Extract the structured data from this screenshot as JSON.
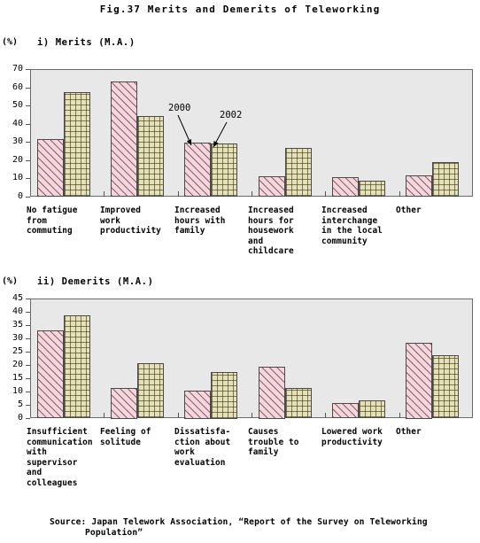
{
  "figure": {
    "title": "Fig.37 Merits and Demerits of Teleworking",
    "source_line1": "Source: Japan Telework Association, “Report of the Survey on Teleworking",
    "source_line2": "Population”"
  },
  "legend_annotations": [
    {
      "label": "2000",
      "series": "2000"
    },
    {
      "label": "2002",
      "series": "2002"
    }
  ],
  "colors": {
    "series_2000_fill": "#f6d5dd",
    "series_2002_fill": "#e4e0b8",
    "plot_background": "#e8e8e8",
    "axis": "#555555",
    "bar_border": "#4a4a4a"
  },
  "panels": [
    {
      "id": "merits",
      "heading": "i) Merits (M.A.)",
      "unit": "(%)"
    },
    {
      "id": "demerits",
      "heading": "ii) Demerits (M.A.)",
      "unit": "(%)"
    }
  ],
  "chart_data": [
    {
      "type": "bar",
      "title": "i) Merits (M.A.)",
      "xlabel": "",
      "ylabel": "(%)",
      "ylim": [
        0,
        70
      ],
      "yticks": [
        0,
        10,
        20,
        30,
        40,
        50,
        60,
        70
      ],
      "grid": false,
      "legend_position": "annotated-arrows",
      "categories": [
        "No fatigue\nfrom\ncommuting",
        "Improved\nwork\nproductivity",
        "Increased\nhours with\nfamily",
        "Increased\nhours for\nhousework\nand\nchildcare",
        "Increased\ninterchange\nin the local\ncommunity",
        "Other"
      ],
      "series": [
        {
          "name": "2000",
          "values": [
            31.5,
            63.0,
            29.6,
            11.2,
            10.6,
            11.6
          ]
        },
        {
          "name": "2002",
          "values": [
            57.4,
            44.4,
            29.2,
            26.8,
            8.6,
            18.8
          ]
        }
      ]
    },
    {
      "type": "bar",
      "title": "ii) Demerits (M.A.)",
      "xlabel": "",
      "ylabel": "(%)",
      "ylim": [
        0,
        45
      ],
      "yticks": [
        0,
        5,
        10,
        15,
        20,
        25,
        30,
        35,
        40,
        45
      ],
      "grid": false,
      "legend_position": "annotated-arrows",
      "categories": [
        "Insufficient\ncommunication\nwith\nsupervisor\nand\ncolleagues",
        "Feeling of\nsolitude",
        "Dissatisfa-\nction about\nwork\nevaluation",
        "Causes\ntrouble to\nfamily",
        "Lowered work\nproductivity",
        "Other"
      ],
      "series": [
        {
          "name": "2000",
          "values": [
            33.0,
            11.5,
            10.5,
            19.5,
            5.7,
            28.5
          ]
        },
        {
          "name": "2002",
          "values": [
            38.6,
            20.8,
            17.5,
            11.2,
            6.7,
            23.8
          ]
        }
      ]
    }
  ]
}
